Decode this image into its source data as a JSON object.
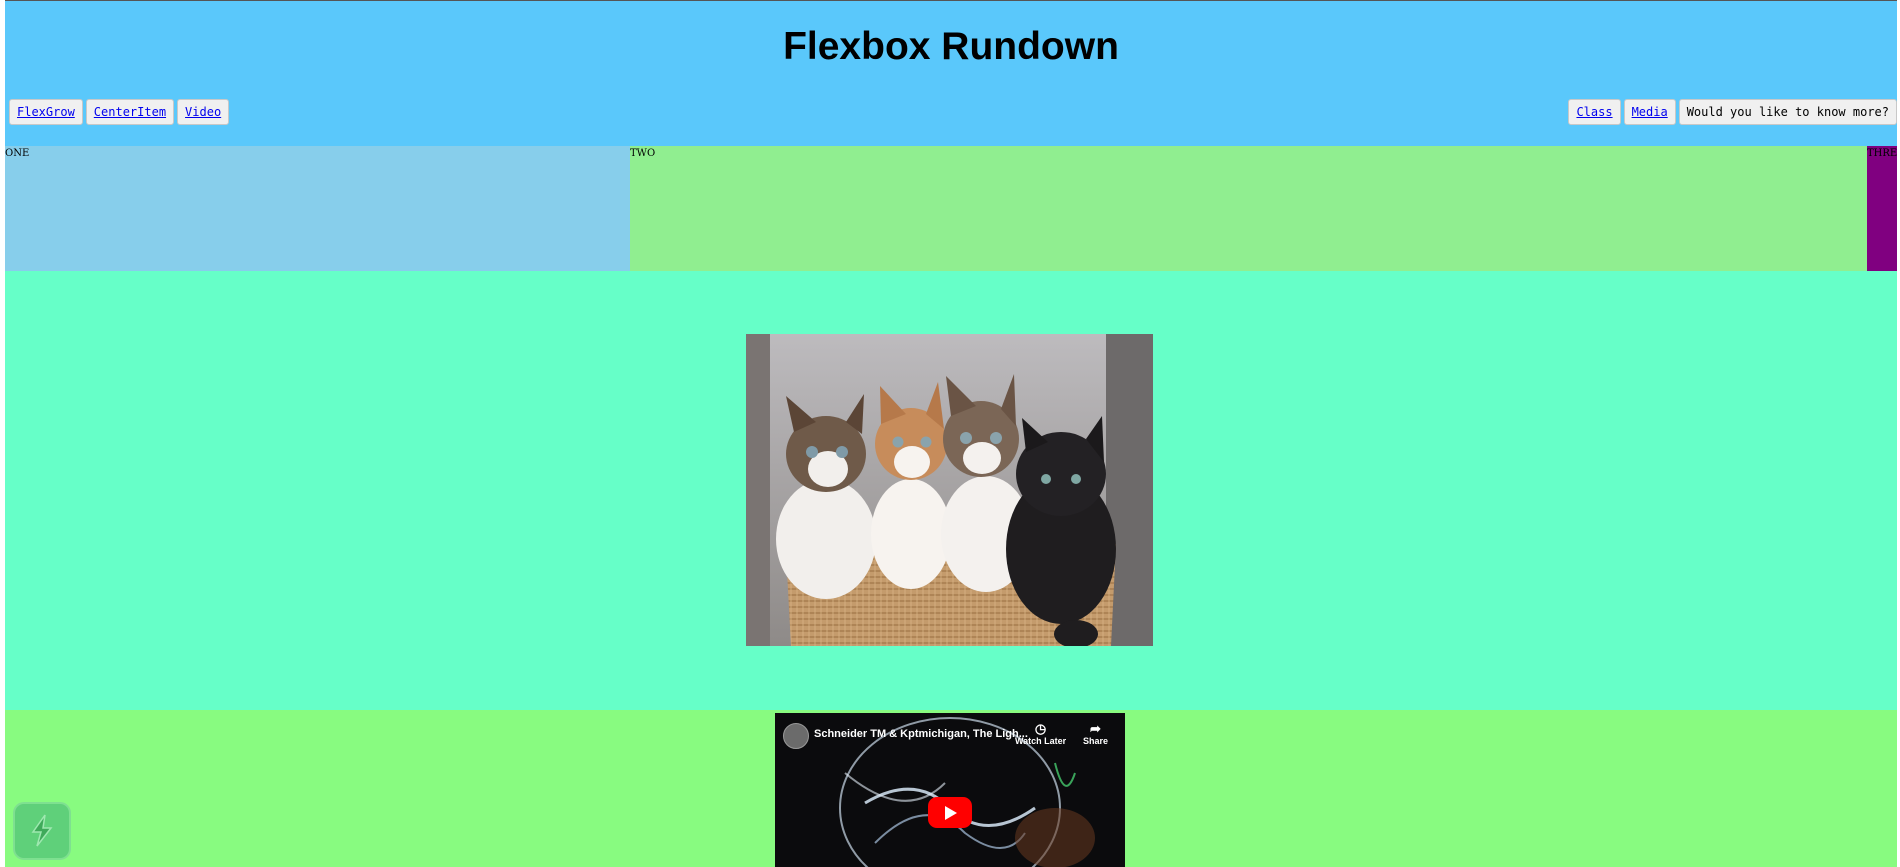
{
  "header": {
    "title": "Flexbox Rundown",
    "nav_left": [
      "FlexGrow",
      "CenterItem",
      "Video"
    ],
    "nav_right": [
      "Class",
      "Media"
    ],
    "nav_button": "Would you like to know more?"
  },
  "flex_boxes": {
    "one": "ONE",
    "two": "TWO",
    "three": "THREE"
  },
  "colors": {
    "header_bg": "#5ac8fb",
    "box_one": "#87ceeb",
    "box_two": "#90ee90",
    "box_three": "#800080",
    "center_bg": "#66ffc8",
    "video_bg": "#88fb80"
  },
  "video": {
    "title": "Schneider TM & Kptmichigan, The Ligh...",
    "watch_later": "Watch Later",
    "share": "Share",
    "icons": [
      "clock-icon",
      "share-icon",
      "play-icon"
    ]
  }
}
